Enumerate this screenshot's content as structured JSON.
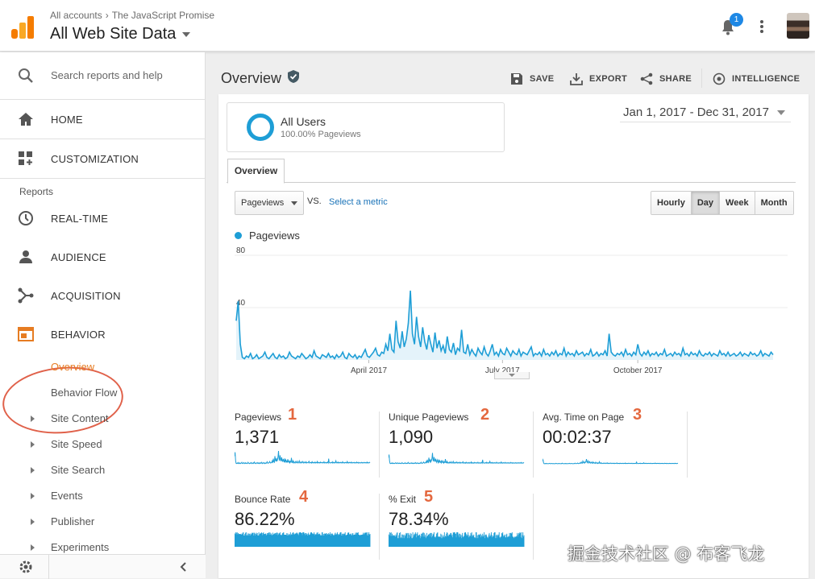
{
  "topbar": {
    "breadcrumb": [
      "All accounts",
      "The JavaScript Promise"
    ],
    "breadcrumb_sep": "›",
    "property": "All Web Site Data",
    "notification_count": "1"
  },
  "sidebar": {
    "search_placeholder": "Search reports and help",
    "home": "HOME",
    "customization": "CUSTOMIZATION",
    "reports_heading": "Reports",
    "realtime": "REAL-TIME",
    "audience": "AUDIENCE",
    "acquisition": "ACQUISITION",
    "behavior": "BEHAVIOR",
    "behavior_items": [
      {
        "label": "Overview",
        "active": true
      },
      {
        "label": "Behavior Flow"
      },
      {
        "label": "Site Content"
      },
      {
        "label": "Site Speed"
      },
      {
        "label": "Site Search"
      },
      {
        "label": "Events"
      },
      {
        "label": "Publisher"
      },
      {
        "label": "Experiments"
      }
    ]
  },
  "header": {
    "title": "Overview",
    "save": "SAVE",
    "export": "EXPORT",
    "share": "SHARE",
    "intelligence": "INTELLIGENCE"
  },
  "segment": {
    "name": "All Users",
    "sub": "100.00% Pageviews"
  },
  "date_range": "Jan 1, 2017 - Dec 31, 2017",
  "tabs": [
    "Overview"
  ],
  "controls": {
    "metric": "Pageviews",
    "vs": "VS.",
    "select_metric": "Select a metric",
    "granularity": [
      "Hourly",
      "Day",
      "Week",
      "Month"
    ],
    "selected_granularity": "Day"
  },
  "chart_data": {
    "type": "line",
    "legend": "Pageviews",
    "y_ticks": [
      "80",
      "40"
    ],
    "ylim": [
      0,
      80
    ],
    "x_tick_labels": [
      "April 2017",
      "July 2017",
      "October 2017"
    ],
    "series": [
      {
        "name": "Pageviews",
        "color": "#1e9ed6",
        "values": [
          30,
          45,
          12,
          2,
          1,
          3,
          2,
          5,
          1,
          2,
          4,
          1,
          2,
          3,
          6,
          2,
          1,
          3,
          5,
          2,
          1,
          4,
          2,
          3,
          1,
          2,
          6,
          3,
          2,
          1,
          3,
          2,
          5,
          3,
          1,
          2,
          4,
          2,
          7,
          3,
          2,
          1,
          4,
          3,
          2,
          5,
          2,
          3,
          1,
          4,
          2,
          3,
          6,
          2,
          1,
          5,
          3,
          2,
          4,
          1,
          3,
          2,
          5,
          8,
          3,
          2,
          4,
          6,
          9,
          4,
          3,
          6,
          5,
          12,
          7,
          20,
          8,
          6,
          30,
          14,
          9,
          22,
          10,
          16,
          28,
          53,
          20,
          12,
          33,
          18,
          10,
          25,
          14,
          8,
          19,
          12,
          6,
          21,
          9,
          15,
          7,
          11,
          5,
          18,
          8,
          6,
          13,
          4,
          9,
          7,
          23,
          6,
          5,
          12,
          4,
          8,
          5,
          3,
          9,
          6,
          4,
          10,
          5,
          3,
          7,
          12,
          4,
          6,
          3,
          8,
          5,
          4,
          9,
          6,
          3,
          7,
          5,
          4,
          8,
          3,
          6,
          5,
          4,
          7,
          10,
          3,
          5,
          4,
          6,
          3,
          8,
          4,
          5,
          3,
          6,
          4,
          7,
          3,
          5,
          4,
          9,
          3,
          6,
          4,
          5,
          3,
          7,
          4,
          5,
          6,
          3,
          5,
          4,
          8,
          3,
          4,
          6,
          3,
          5,
          4,
          7,
          3,
          20,
          6,
          4,
          3,
          5,
          4,
          6,
          3,
          8,
          4,
          5,
          3,
          6,
          4,
          12,
          5,
          3,
          6,
          4,
          7,
          3,
          5,
          4,
          6,
          3,
          5,
          4,
          8,
          3,
          4,
          5,
          3,
          6,
          4,
          5,
          3,
          9,
          4,
          5,
          3,
          6,
          4,
          5,
          3,
          7,
          4,
          3,
          5,
          4,
          6,
          3,
          5,
          4,
          3,
          7,
          4,
          5,
          3,
          6,
          3,
          4,
          5,
          3,
          4,
          6,
          3,
          5,
          4,
          3,
          6,
          4,
          5,
          3,
          4,
          7,
          3,
          5,
          4,
          3,
          6,
          4
        ]
      }
    ]
  },
  "scorecards": [
    {
      "label": "Pageviews",
      "value": "1,371",
      "marker": "1"
    },
    {
      "label": "Unique Pageviews",
      "value": "1,090",
      "marker": "2"
    },
    {
      "label": "Avg. Time on Page",
      "value": "00:02:37",
      "marker": "3"
    },
    {
      "label": "Bounce Rate",
      "value": "86.22%",
      "marker": "4"
    },
    {
      "label": "% Exit",
      "value": "78.34%",
      "marker": "5"
    }
  ],
  "watermark": "掘金技术社区 @ 布客飞龙"
}
